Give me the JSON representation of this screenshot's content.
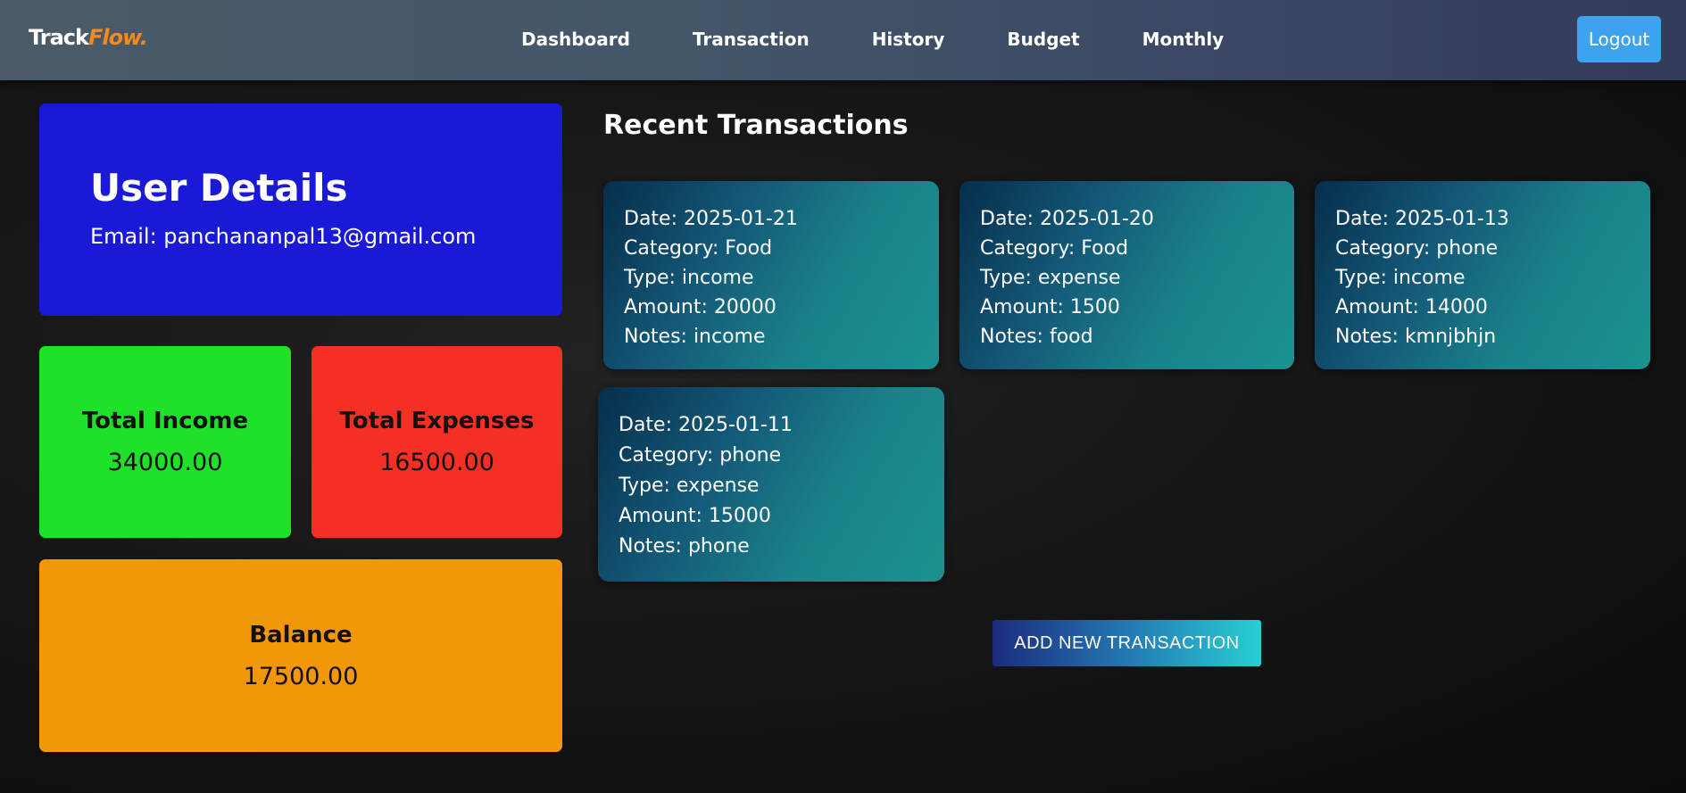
{
  "app": {
    "logo_part1": "Track",
    "logo_part2": "Flow."
  },
  "nav": {
    "items": [
      {
        "label": "Dashboard"
      },
      {
        "label": "Transaction"
      },
      {
        "label": "History"
      },
      {
        "label": "Budget"
      },
      {
        "label": "Monthly"
      }
    ],
    "logout_label": "Logout"
  },
  "user": {
    "title": "User Details",
    "email": "Email: panchananpal13@gmail.com"
  },
  "summary": {
    "income_label": "Total Income",
    "income_value": "34000.00",
    "expenses_label": "Total Expenses",
    "expenses_value": "16500.00",
    "balance_label": "Balance",
    "balance_value": "17500.00"
  },
  "transactions": {
    "title": "Recent Transactions",
    "items": [
      {
        "date": "Date: 2025-01-21",
        "category": "Category: Food",
        "type": "Type: income",
        "amount": "Amount: 20000",
        "notes": "Notes: income"
      },
      {
        "date": "Date: 2025-01-20",
        "category": "Category: Food",
        "type": "Type: expense",
        "amount": "Amount: 1500",
        "notes": "Notes: food"
      },
      {
        "date": "Date: 2025-01-13",
        "category": "Category: phone",
        "type": "Type: income",
        "amount": "Amount: 14000",
        "notes": "Notes: kmnjbhjn"
      },
      {
        "date": "Date: 2025-01-11",
        "category": "Category: phone",
        "type": "Type: expense",
        "amount": "Amount: 15000",
        "notes": "Notes: phone"
      }
    ],
    "add_button_label": "ADD NEW TRANSACTION"
  },
  "colors": {
    "brand_accent": "#f58a1f",
    "logout_button": "#3da3ef",
    "user_card": "#1a19d6",
    "income_card": "#1ee22a",
    "expenses_card": "#f62f24",
    "balance_card": "#f29708"
  }
}
